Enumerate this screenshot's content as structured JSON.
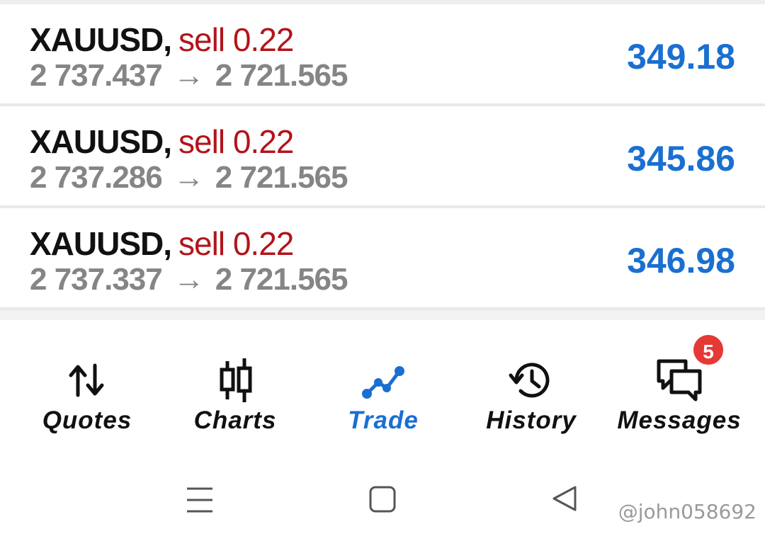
{
  "trades": [
    {
      "symbol": "XAUUSD",
      "side": "sell 0.22",
      "open_price": "2 737.437",
      "arrow": "→",
      "current_price": "2 721.565",
      "profit": "349.18"
    },
    {
      "symbol": "XAUUSD",
      "side": "sell 0.22",
      "open_price": "2 737.286",
      "arrow": "→",
      "current_price": "2 721.565",
      "profit": "345.86"
    },
    {
      "symbol": "XAUUSD",
      "side": "sell 0.22",
      "open_price": "2 737.337",
      "arrow": "→",
      "current_price": "2 721.565",
      "profit": "346.98"
    }
  ],
  "tabs": [
    {
      "label": "Quotes",
      "icon": "quotes-arrows-icon"
    },
    {
      "label": "Charts",
      "icon": "candlestick-icon"
    },
    {
      "label": "Trade",
      "icon": "trade-line-icon",
      "active": true
    },
    {
      "label": "History",
      "icon": "history-clock-icon"
    },
    {
      "label": "Messages",
      "icon": "messages-icon",
      "badge": "5"
    }
  ],
  "system_nav": [
    "menu-icon",
    "home-square-icon",
    "back-triangle-icon"
  ],
  "watermark": "@john058692",
  "colors": {
    "sell": "#b3141b",
    "profit": "#1a6fd1",
    "active_tab": "#1a6fd1",
    "badge": "#e53935"
  }
}
